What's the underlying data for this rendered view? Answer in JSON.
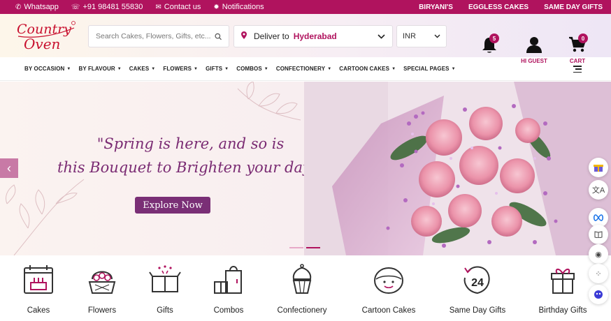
{
  "topbar": {
    "whatsapp": "Whatsapp",
    "phone": "+91 98481 55830",
    "contact": "Contact us",
    "notifications": "Notifications",
    "links": [
      "BIRYANI'S",
      "EGGLESS CAKES",
      "SAME DAY GIFTS"
    ]
  },
  "header": {
    "logo_line1": "Country",
    "logo_line2": "Oven",
    "search_placeholder": "Search Cakes, Flowers, Gifts, etc...",
    "deliver_label": "Deliver to",
    "deliver_city": "Hyderabad",
    "currency": "INR",
    "notification_count": "5",
    "user_label": "HI GUEST",
    "cart_label": "CART",
    "cart_count": "0"
  },
  "nav": {
    "items": [
      "BY OCCASION",
      "BY FLAVOUR",
      "CAKES",
      "FLOWERS",
      "GIFTS",
      "COMBOS",
      "CONFECTIONERY",
      "CARTOON CAKES",
      "SPECIAL PAGES"
    ]
  },
  "hero": {
    "line1": "\"Spring is here, and so is",
    "line2": "this Bouquet to Brighten your day!\"",
    "cta": "Explore Now",
    "slide_count": 2,
    "active_slide": 2
  },
  "categories": [
    "Cakes",
    "Flowers",
    "Gifts",
    "Combos",
    "Confectionery",
    "Cartoon Cakes",
    "Same Day Gifts",
    "Birthday Gifts"
  ],
  "colors": {
    "brand": "#b0135e",
    "accent": "#7a2f76"
  }
}
